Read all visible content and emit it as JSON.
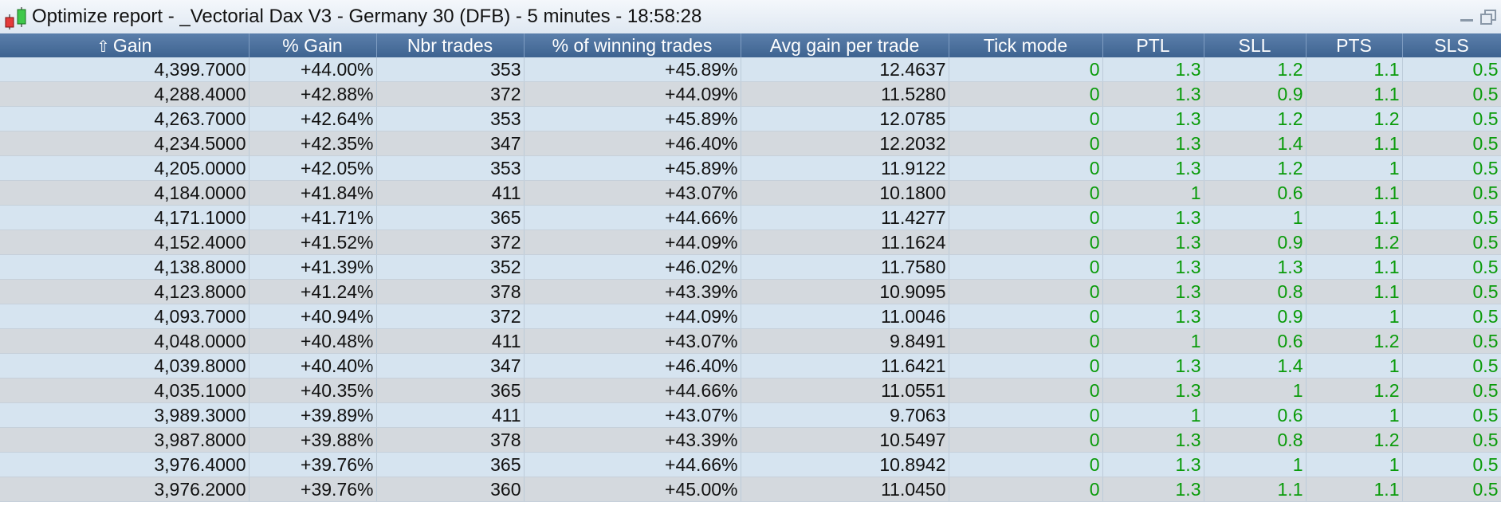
{
  "window": {
    "title": "Optimize report - _Vectorial Dax V3 - Germany 30 (DFB) - 5 minutes - 18:58:28",
    "icon": "candlestick-chart-icon",
    "controls": [
      "minimize-icon",
      "restore-icon"
    ]
  },
  "table": {
    "sorted_column": "Gain",
    "sort_direction": "descending",
    "columns": [
      "Gain",
      "% Gain",
      "Nbr trades",
      "% of winning trades",
      "Avg gain per trade",
      "Tick mode",
      "PTL",
      "SLL",
      "PTS",
      "SLS"
    ],
    "rows": [
      [
        "4,399.7000",
        "+44.00%",
        "353",
        "+45.89%",
        "12.4637",
        "0",
        "1.3",
        "1.2",
        "1.1",
        "0.5"
      ],
      [
        "4,288.4000",
        "+42.88%",
        "372",
        "+44.09%",
        "11.5280",
        "0",
        "1.3",
        "0.9",
        "1.1",
        "0.5"
      ],
      [
        "4,263.7000",
        "+42.64%",
        "353",
        "+45.89%",
        "12.0785",
        "0",
        "1.3",
        "1.2",
        "1.2",
        "0.5"
      ],
      [
        "4,234.5000",
        "+42.35%",
        "347",
        "+46.40%",
        "12.2032",
        "0",
        "1.3",
        "1.4",
        "1.1",
        "0.5"
      ],
      [
        "4,205.0000",
        "+42.05%",
        "353",
        "+45.89%",
        "11.9122",
        "0",
        "1.3",
        "1.2",
        "1",
        "0.5"
      ],
      [
        "4,184.0000",
        "+41.84%",
        "411",
        "+43.07%",
        "10.1800",
        "0",
        "1",
        "0.6",
        "1.1",
        "0.5"
      ],
      [
        "4,171.1000",
        "+41.71%",
        "365",
        "+44.66%",
        "11.4277",
        "0",
        "1.3",
        "1",
        "1.1",
        "0.5"
      ],
      [
        "4,152.4000",
        "+41.52%",
        "372",
        "+44.09%",
        "11.1624",
        "0",
        "1.3",
        "0.9",
        "1.2",
        "0.5"
      ],
      [
        "4,138.8000",
        "+41.39%",
        "352",
        "+46.02%",
        "11.7580",
        "0",
        "1.3",
        "1.3",
        "1.1",
        "0.5"
      ],
      [
        "4,123.8000",
        "+41.24%",
        "378",
        "+43.39%",
        "10.9095",
        "0",
        "1.3",
        "0.8",
        "1.1",
        "0.5"
      ],
      [
        "4,093.7000",
        "+40.94%",
        "372",
        "+44.09%",
        "11.0046",
        "0",
        "1.3",
        "0.9",
        "1",
        "0.5"
      ],
      [
        "4,048.0000",
        "+40.48%",
        "411",
        "+43.07%",
        "9.8491",
        "0",
        "1",
        "0.6",
        "1.2",
        "0.5"
      ],
      [
        "4,039.8000",
        "+40.40%",
        "347",
        "+46.40%",
        "11.6421",
        "0",
        "1.3",
        "1.4",
        "1",
        "0.5"
      ],
      [
        "4,035.1000",
        "+40.35%",
        "365",
        "+44.66%",
        "11.0551",
        "0",
        "1.3",
        "1",
        "1.2",
        "0.5"
      ],
      [
        "3,989.3000",
        "+39.89%",
        "411",
        "+43.07%",
        "9.7063",
        "0",
        "1",
        "0.6",
        "1",
        "0.5"
      ],
      [
        "3,987.8000",
        "+39.88%",
        "378",
        "+43.39%",
        "10.5497",
        "0",
        "1.3",
        "0.8",
        "1.2",
        "0.5"
      ],
      [
        "3,976.4000",
        "+39.76%",
        "365",
        "+44.66%",
        "10.8942",
        "0",
        "1.3",
        "1",
        "1",
        "0.5"
      ],
      [
        "3,976.2000",
        "+39.76%",
        "360",
        "+45.00%",
        "11.0450",
        "0",
        "1.3",
        "1.1",
        "1.1",
        "0.5"
      ]
    ]
  },
  "colors": {
    "header_bg": "#4a6e9c",
    "row_odd": "#d6e4f0",
    "row_even": "#d4d9de",
    "param_text": "#0a9b0a"
  }
}
